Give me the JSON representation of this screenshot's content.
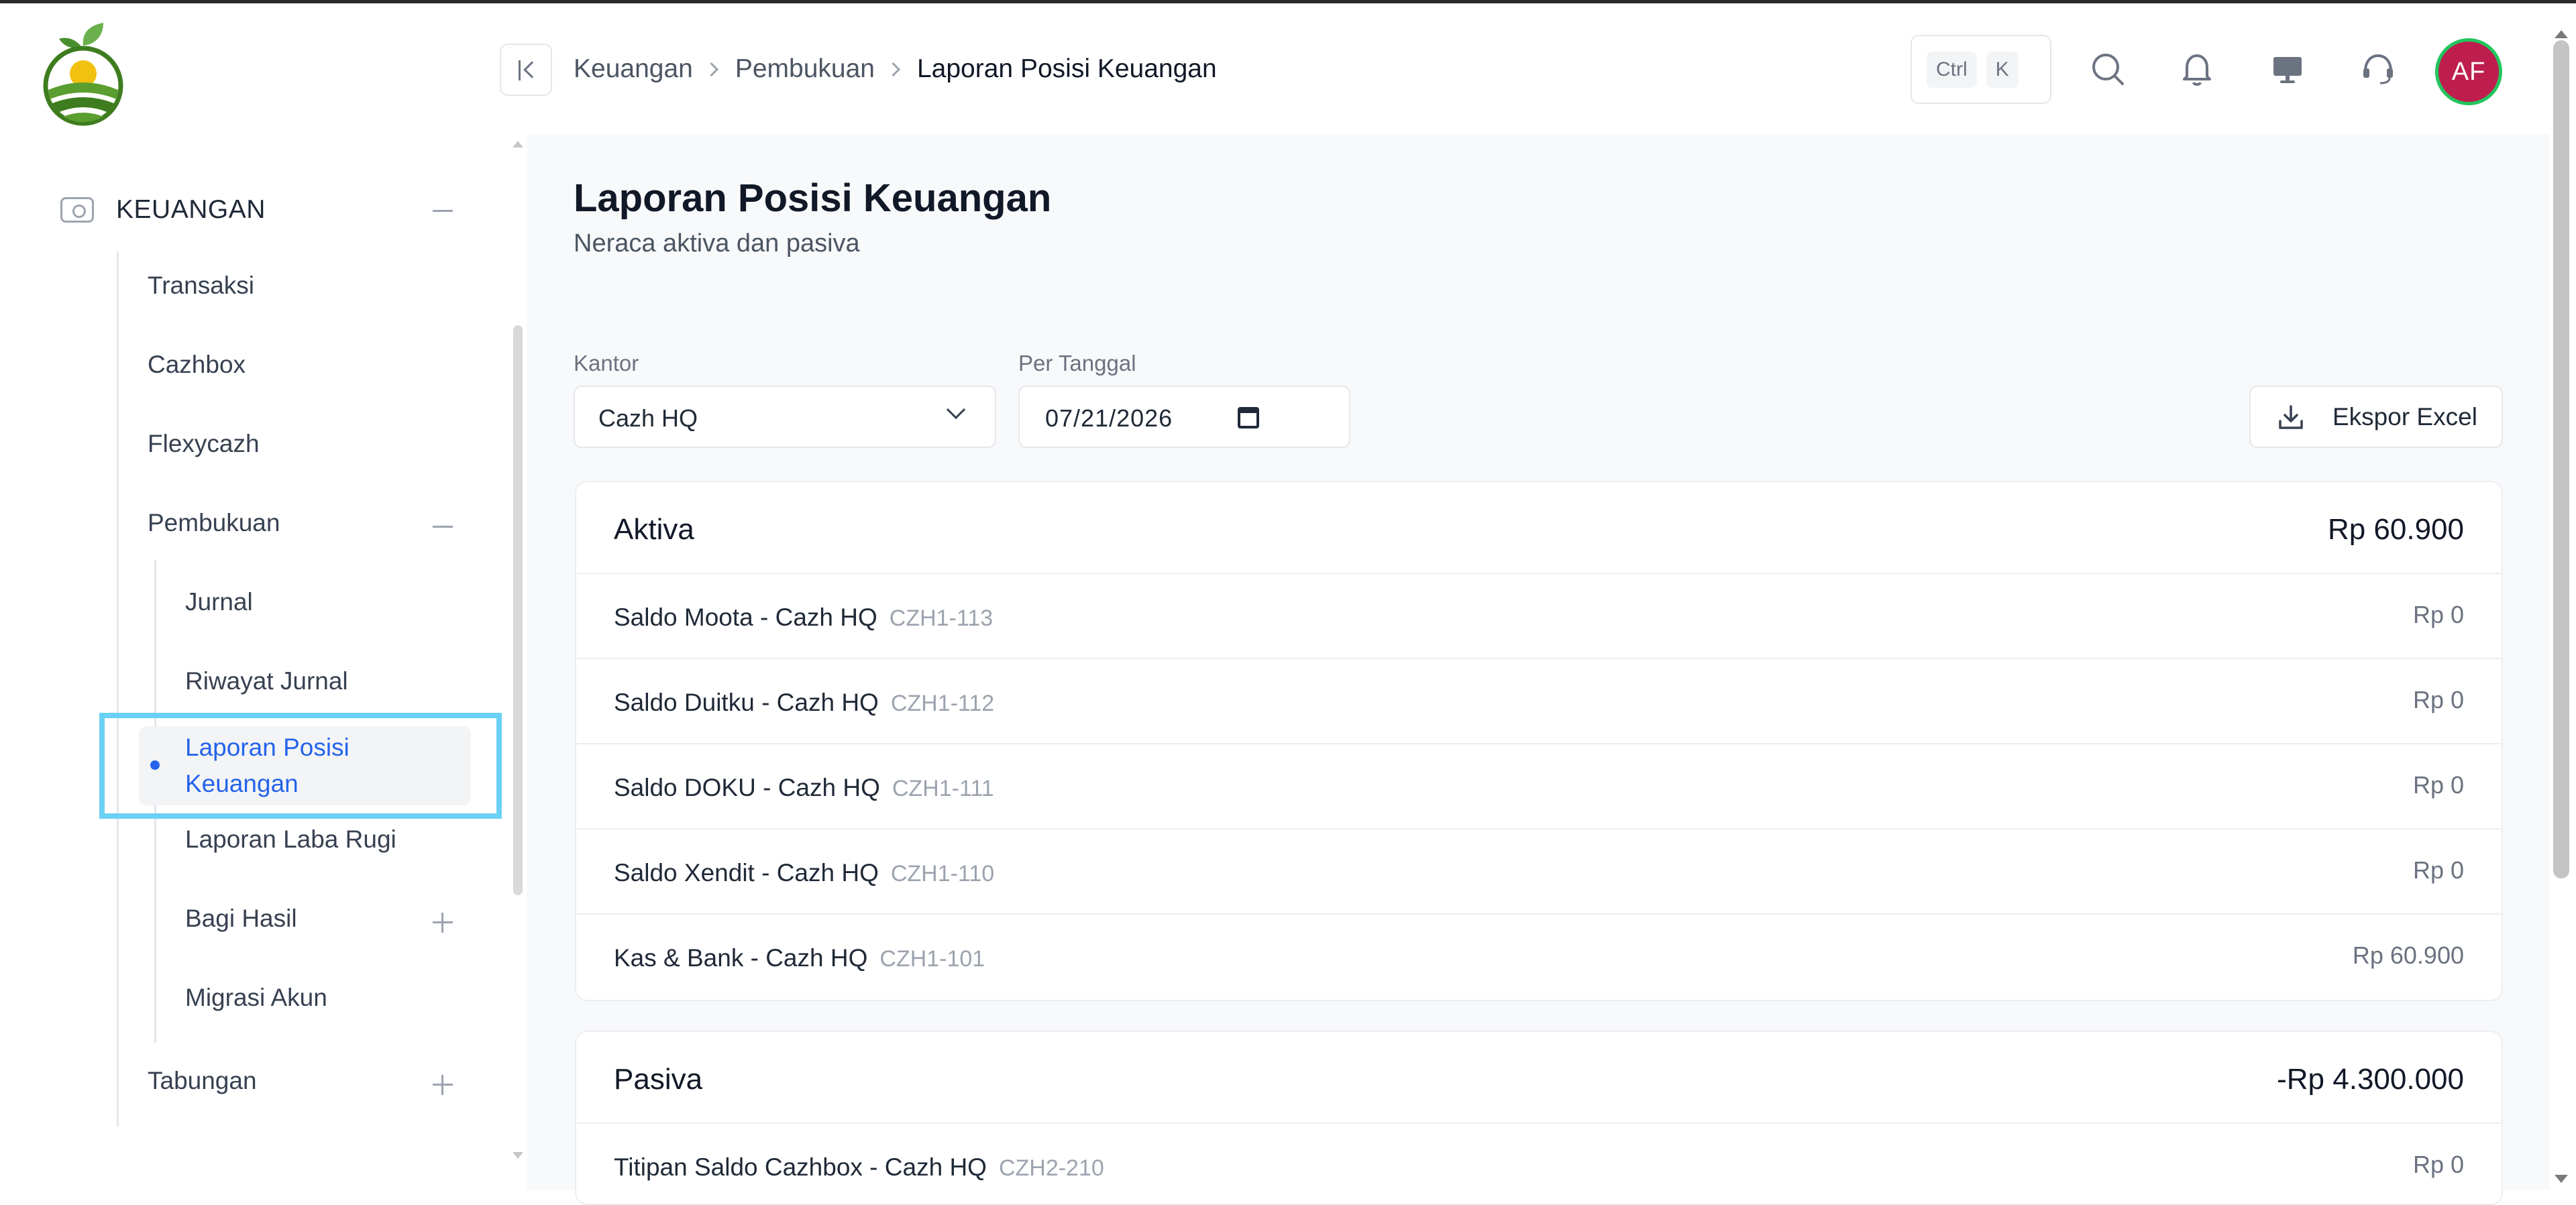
{
  "sidebar": {
    "group_label": "KEUANGAN",
    "items": [
      {
        "label": "Transaksi"
      },
      {
        "label": "Cazhbox"
      },
      {
        "label": "Flexycazh"
      },
      {
        "label": "Pembukuan"
      },
      {
        "label": "Tabungan"
      }
    ],
    "pembukuan_children": [
      {
        "label": "Jurnal"
      },
      {
        "label": "Riwayat Jurnal"
      },
      {
        "label": "Laporan Posisi Keuangan",
        "active": true
      },
      {
        "label": "Laporan Laba Rugi"
      },
      {
        "label": "Bagi Hasil"
      },
      {
        "label": "Migrasi Akun"
      }
    ]
  },
  "header": {
    "breadcrumb": [
      "Keuangan",
      "Pembukuan",
      "Laporan Posisi Keuangan"
    ],
    "shortcut": [
      "Ctrl",
      "K"
    ],
    "icons": [
      "search-icon",
      "bell-icon",
      "monitor-icon",
      "headset-icon"
    ],
    "avatar_initials": "AF",
    "avatar_color": "#be1e4e"
  },
  "page": {
    "title": "Laporan Posisi Keuangan",
    "subtitle": "Neraca aktiva dan pasiva"
  },
  "filters": {
    "kantor_label": "Kantor",
    "kantor_value": "Cazh HQ",
    "tanggal_label": "Per Tanggal",
    "tanggal_value": "07/21/2026",
    "export_label": "Ekspor Excel"
  },
  "aktiva": {
    "title": "Aktiva",
    "total": "Rp 60.900",
    "rows": [
      {
        "name": "Saldo Moota - Cazh HQ",
        "code": "CZH1-113",
        "amount": "Rp 0"
      },
      {
        "name": "Saldo Duitku - Cazh HQ",
        "code": "CZH1-112",
        "amount": "Rp 0"
      },
      {
        "name": "Saldo DOKU - Cazh HQ",
        "code": "CZH1-111",
        "amount": "Rp 0"
      },
      {
        "name": "Saldo Xendit - Cazh HQ",
        "code": "CZH1-110",
        "amount": "Rp 0"
      },
      {
        "name": "Kas & Bank - Cazh HQ",
        "code": "CZH1-101",
        "amount": "Rp 60.900"
      }
    ]
  },
  "pasiva": {
    "title": "Pasiva",
    "total": "-Rp 4.300.000",
    "rows": [
      {
        "name": "Titipan Saldo Cazhbox - Cazh HQ",
        "code": "CZH2-210",
        "amount": "Rp 0"
      }
    ]
  },
  "colors": {
    "accent": "#2563eb",
    "highlight": "#6bd0f5"
  }
}
